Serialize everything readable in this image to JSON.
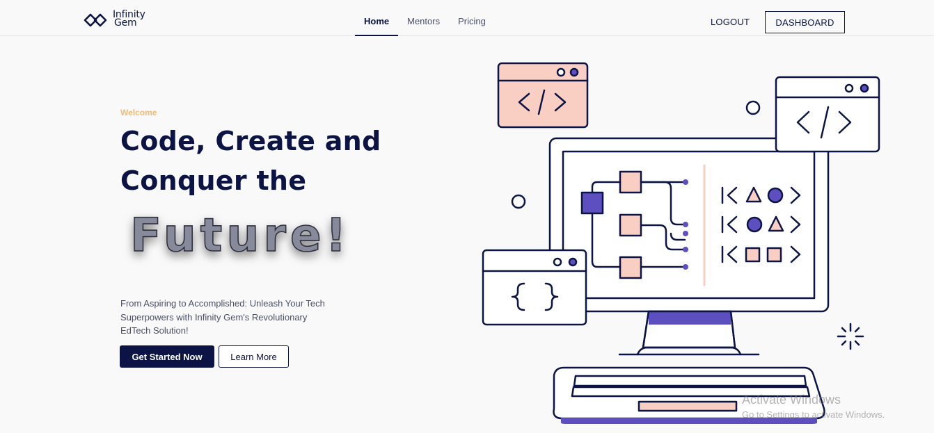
{
  "brand": {
    "line1": "Infinity",
    "line2": "Gem"
  },
  "nav": {
    "home": "Home",
    "mentors": "Mentors",
    "pricing": "Pricing"
  },
  "header": {
    "logout": "LOGOUT",
    "dashboard": "DASHBOARD"
  },
  "hero": {
    "welcome": "Welcome",
    "headline_line1": "Code, Create and",
    "headline_line2": "Conquer the",
    "highlight": "Future!",
    "description": "From Aspiring to Accomplished: Unleash Your Tech Superpowers with Infinity Gem's Revolutionary EdTech Solution!",
    "primary_cta": "Get Started Now",
    "secondary_cta": "Learn More"
  },
  "illustration": {
    "code_tag": "</>",
    "braces": "{ }",
    "icons": [
      "code-window-icon",
      "monitor-icon",
      "flowchart-icon",
      "braces-window-icon",
      "keyboard-icon",
      "sparkle-icon"
    ]
  },
  "watermark": {
    "title": "Activate Windows",
    "subtitle": "Go to Settings to activate Windows."
  },
  "colors": {
    "navy": "#0b1445",
    "accent_orange": "#f4b976",
    "peach": "#f9cfc3",
    "purple": "#5d4fc0"
  }
}
